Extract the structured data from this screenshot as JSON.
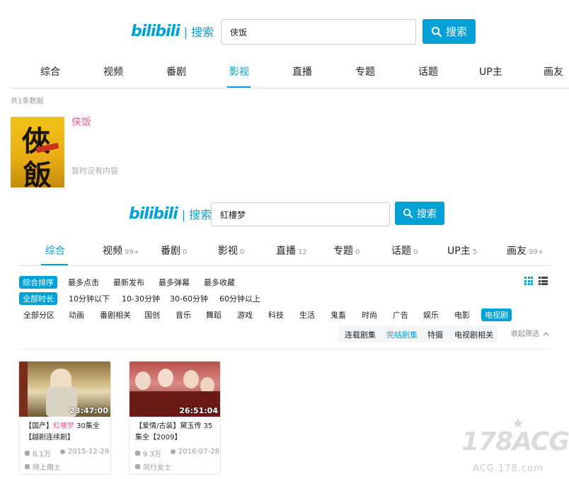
{
  "top": {
    "logo": "bilibili",
    "logo_sep": "|",
    "logo_search": "搜索",
    "search_value": "侠饭",
    "search_button": "搜索",
    "tabs": [
      "综合",
      "视频",
      "番剧",
      "影视",
      "直播",
      "专题",
      "话题",
      "UP主",
      "画友"
    ],
    "active_tab": "影视",
    "result_count": "共1条数据",
    "result": {
      "title": "侠饭",
      "empty_text": "暂时没有内容",
      "poster_chars": [
        "俠",
        "飯"
      ]
    }
  },
  "bottom": {
    "logo": "bilibili",
    "logo_sep": "|",
    "logo_search": "搜索",
    "search_value": "紅樓梦",
    "search_button": "搜索",
    "tabs": [
      {
        "label": "综合",
        "count": ""
      },
      {
        "label": "视频",
        "count": "99+"
      },
      {
        "label": "番剧",
        "count": "0"
      },
      {
        "label": "影视",
        "count": "0"
      },
      {
        "label": "直播",
        "count": "12"
      },
      {
        "label": "专题",
        "count": "0"
      },
      {
        "label": "话题",
        "count": "0"
      },
      {
        "label": "UP主",
        "count": "5"
      },
      {
        "label": "画友",
        "count": "99+"
      }
    ],
    "sort_options": [
      "综合排序",
      "最多点击",
      "最新发布",
      "最多弹幕",
      "最多收藏"
    ],
    "duration_options": [
      "全部时长",
      "10分钟以下",
      "10-30分钟",
      "30-60分钟",
      "60分钟以上"
    ],
    "zones": [
      "全部分区",
      "动画",
      "番剧相关",
      "国创",
      "音乐",
      "舞蹈",
      "游戏",
      "科技",
      "生活",
      "鬼畜",
      "时尚",
      "广告",
      "娱乐",
      "电影",
      "电视剧"
    ],
    "sub_zones": [
      "连载剧集",
      "完结剧集",
      "特摄",
      "电视剧相关"
    ],
    "active_sub_zone": "完结剧集",
    "collapse_label": "收起筛选",
    "videos": [
      {
        "duration": "23:47:00",
        "title_prefix": "【国产】",
        "title_highlight": "紅樓梦",
        "title_suffix": " 30集全【越剧连续剧】",
        "views": "6.1万",
        "date": "2015-12-29",
        "uploader": "持上南士"
      },
      {
        "duration": "26:51:04",
        "title_prefix": "【爱情/古装】黛玉传 35集全【2009】",
        "title_highlight": "",
        "title_suffix": "",
        "views": "9.3万",
        "date": "2016-07-28",
        "uploader": "风行女士"
      }
    ]
  },
  "watermark": {
    "big": "178ACG",
    "small": "ACG.178.com"
  },
  "colors": {
    "accent": "#00a1d6",
    "highlight": "#f25d8e"
  }
}
